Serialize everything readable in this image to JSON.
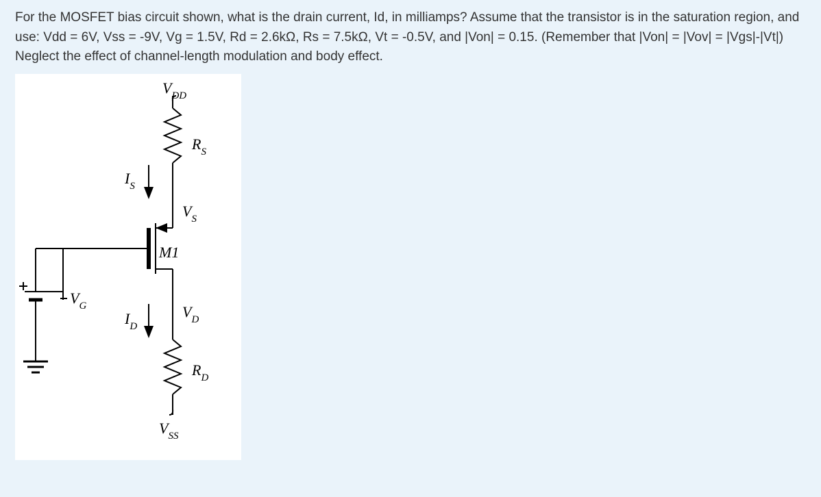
{
  "question": "For the MOSFET bias circuit shown, what is the drain current, Id, in milliamps? Assume that the transistor is in the saturation region, and use: Vdd = 6V, Vss = -9V, Vg = 1.5V, Rd = 2.6kΩ, Rs = 7.5kΩ, Vt = -0.5V, and |Von| = 0.15. (Remember that |Von| = |Vov| = |Vgs|-|Vt|) Neglect the effect of channel-length modulation and body effect.",
  "labels": {
    "vdd": "V",
    "vdd_sub": "DD",
    "rs": "R",
    "rs_sub": "S",
    "is": "I",
    "is_sub": "S",
    "vs": "V",
    "vs_sub": "S",
    "m1": "M1",
    "vg": "V",
    "vg_sub": "G",
    "id": "I",
    "id_sub": "D",
    "vd": "V",
    "vd_sub": "D",
    "rd": "R",
    "rd_sub": "D",
    "vss": "V",
    "vss_sub": "SS"
  }
}
